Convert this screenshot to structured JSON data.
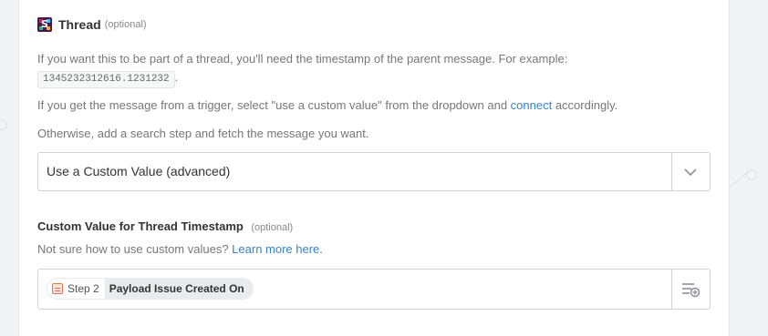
{
  "thread_field": {
    "icon": "slack-icon",
    "label": "Thread",
    "optional": "(optional)",
    "help_line1_pre": "If you want this to be part of a thread, you'll need the timestamp of the parent message. For example:",
    "example_timestamp": "1345232312616.1231232",
    "example_suffix": ".",
    "help_line2_pre": "If you get the message from a trigger, select \"use a custom value\" from the dropdown and ",
    "help_line2_link": "connect",
    "help_line2_post": " accordingly.",
    "help_line3": "Otherwise, add a search step and fetch the message you want.",
    "dropdown_value": "Use a Custom Value (advanced)"
  },
  "custom_value_field": {
    "label": "Custom Value for Thread Timestamp",
    "optional": "(optional)",
    "help_pre": "Not sure how to use custom values? ",
    "help_link": "Learn more here.",
    "pill": {
      "step": "Step 2",
      "text": "Payload Issue Created On"
    }
  },
  "colors": {
    "link": "#3b82c4",
    "slack_brand": "#4a154b",
    "pill_icon": "#e37554"
  }
}
